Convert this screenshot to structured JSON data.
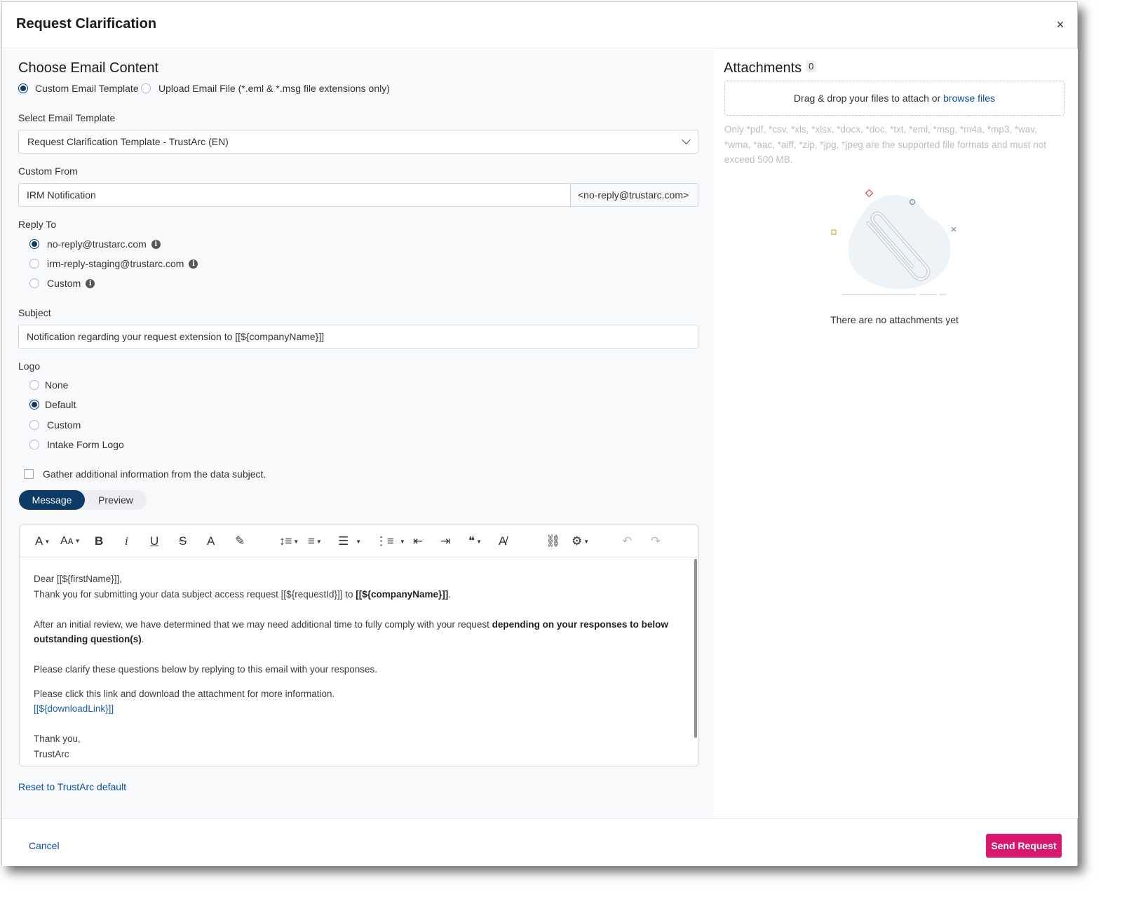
{
  "modal": {
    "title": "Request Clarification",
    "close_glyph": "×"
  },
  "email_content": {
    "heading": "Choose Email Content",
    "source_options": [
      {
        "label": "Custom Email Template",
        "checked": true
      },
      {
        "label": "Upload Email File (*.eml & *.msg file extensions only)",
        "checked": false
      }
    ],
    "template_label": "Select Email Template",
    "template_value": "Request Clarification Template - TrustArc (EN)",
    "custom_from_label": "Custom From",
    "custom_from_value": "IRM Notification",
    "custom_from_suffix": "<no-reply@trustarc.com>",
    "reply_to_label": "Reply To",
    "reply_to_options": [
      {
        "label": "no-reply@trustarc.com",
        "checked": true
      },
      {
        "label": "irm-reply-staging@trustarc.com",
        "checked": false
      },
      {
        "label": "Custom",
        "checked": false
      }
    ],
    "subject_label": "Subject",
    "subject_value": "Notification regarding your request extension to [[${companyName}]]",
    "logo_label": "Logo",
    "logo_options": [
      {
        "label": "None",
        "checked": false
      },
      {
        "label": "Default",
        "checked": true
      },
      {
        "label": "Custom",
        "checked": false
      },
      {
        "label": "Intake Form Logo",
        "checked": false
      }
    ],
    "gather_label": "Gather additional information from the data subject.",
    "gather_checked": false,
    "tabs": {
      "message": "Message",
      "preview": "Preview",
      "active": "Message"
    },
    "reset_link": "Reset to TrustArc default"
  },
  "toolbar": {
    "font": "A",
    "font_size": "Aᴀ",
    "bold": "B",
    "italic": "i",
    "underline": "U",
    "strike": "S",
    "text_color": "A",
    "highlight": "✎",
    "line_height": "↕≡",
    "align": "≡",
    "bullets": "☰",
    "numbered": "⋮≡",
    "outdent": "⇤",
    "indent": "⇥",
    "quote": "❝",
    "clear": "A̸",
    "link": "⛓",
    "settings": "⚙",
    "undo": "↶",
    "redo": "↷"
  },
  "message": {
    "line1": "Dear [[${firstName}]],",
    "line2_prefix": "Thank you for submitting your data subject access request [[${requestId}]] to ",
    "line2_bold": "[[${companyName}]]",
    "line2_suffix": ".",
    "para2_prefix": "After an initial review, we have determined that we may need additional time to fully comply with your request ",
    "para2_bold1": "depending on your responses to below",
    "para2_bold2": "outstanding question(s)",
    "para2_suffix": ".",
    "para3": "Please clarify these questions below by replying to this email with your responses.",
    "para4": "Please click this link and download the attachment for more information.",
    "download_link": "[[${downloadLink}]]",
    "closing1": "Thank you,",
    "closing2": "TrustArc"
  },
  "attachments": {
    "heading": "Attachments",
    "count": "0",
    "drop_text": "Drag & drop your files to attach or ",
    "browse_text": "browse files",
    "formats_text": "Only *pdf, *csv, *xls, *xlsx, *docx, *doc, *txt, *eml, *msg, *m4a, *mp3, *wav, *wma, *aac, *aiff, *zip, *jpg, *jpeg are the supported file formats and must not exceed 500 MB.",
    "empty_text": "There are no attachments yet",
    "empty_icon": "paperclip-icon"
  },
  "footer": {
    "cancel": "Cancel",
    "send": "Send Request"
  },
  "colors": {
    "primary": "#0d3a66",
    "accent": "#d8186d",
    "link": "#0b4fa3"
  }
}
